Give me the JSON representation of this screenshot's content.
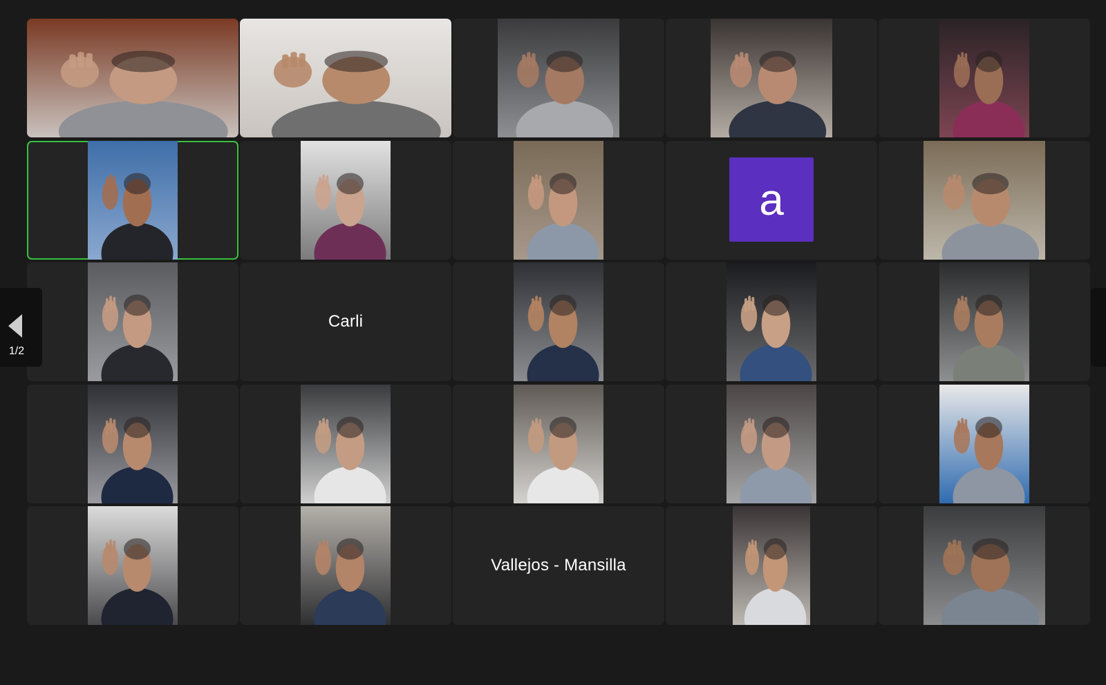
{
  "app": "Video meeting gallery view",
  "pager": {
    "label": "1/2"
  },
  "tiles": [
    {
      "kind": "video",
      "name": "participant-01",
      "bg": [
        "#7a3a24",
        "#c9c2bd"
      ],
      "skin": "#c49a82",
      "cloth": "#8f9196"
    },
    {
      "kind": "video",
      "name": "participant-02",
      "bg": [
        "#e8e5e2",
        "#c9c4bf"
      ],
      "skin": "#b78a6c",
      "cloth": "#6f6f70"
    },
    {
      "kind": "video",
      "name": "participant-03",
      "bg": [
        "#3b3b3d",
        "#8d8f93"
      ],
      "skin": "#a47a62",
      "cloth": "#a7a9ad"
    },
    {
      "kind": "video",
      "name": "participant-04",
      "bg": [
        "#3a3432",
        "#b4aca4"
      ],
      "skin": "#b88a72",
      "cloth": "#2f3542"
    },
    {
      "kind": "video",
      "name": "participant-05",
      "bg": [
        "#2a2326",
        "#7d4552"
      ],
      "skin": "#9a6d55",
      "cloth": "#8a2e57"
    },
    {
      "kind": "video",
      "name": "participant-06",
      "bg": [
        "#3f6ea8",
        "#8aa8cf"
      ],
      "skin": "#a26e52",
      "cloth": "#24252b",
      "active": true
    },
    {
      "kind": "video",
      "name": "participant-07",
      "bg": [
        "#e2e2e2",
        "#7b7b7b"
      ],
      "skin": "#caa48f",
      "cloth": "#6e2f57"
    },
    {
      "kind": "video",
      "name": "participant-08",
      "bg": [
        "#7a6a57",
        "#a7988b"
      ],
      "skin": "#c4987e",
      "cloth": "#8c98a7"
    },
    {
      "kind": "avatar",
      "name": "participant-avatar",
      "letter": "a",
      "color": "#5b2fbf"
    },
    {
      "kind": "video",
      "name": "participant-10",
      "bg": [
        "#7b6c57",
        "#bdb7aa"
      ],
      "skin": "#b78a6e",
      "cloth": "#8c939d"
    },
    {
      "kind": "video",
      "name": "participant-11",
      "bg": [
        "#5a5c60",
        "#9a9b9e"
      ],
      "skin": "#c49a82",
      "cloth": "#27292f"
    },
    {
      "kind": "name",
      "name": "participant-carli",
      "label": "Carli"
    },
    {
      "kind": "video",
      "name": "participant-13",
      "bg": [
        "#2f3136",
        "#8c8d90"
      ],
      "skin": "#b28362",
      "cloth": "#253049"
    },
    {
      "kind": "video",
      "name": "participant-14",
      "bg": [
        "#1b1c1f",
        "#6b6b6e"
      ],
      "skin": "#c8a085",
      "cloth": "#33507e"
    },
    {
      "kind": "video",
      "name": "participant-15",
      "bg": [
        "#2b2c2e",
        "#8e8f91"
      ],
      "skin": "#a97c5f",
      "cloth": "#7a8077"
    },
    {
      "kind": "video",
      "name": "participant-16",
      "bg": [
        "#2e3036",
        "#9a9aa0"
      ],
      "skin": "#b78a6e",
      "cloth": "#1e2a42"
    },
    {
      "kind": "video",
      "name": "participant-17",
      "bg": [
        "#3a3b3e",
        "#cfcfcf"
      ],
      "skin": "#c39c83",
      "cloth": "#e6e6e6"
    },
    {
      "kind": "video",
      "name": "participant-18",
      "bg": [
        "#5f5a55",
        "#d4d2cf"
      ],
      "skin": "#c29a80",
      "cloth": "#e7e7e7"
    },
    {
      "kind": "video",
      "name": "participant-19",
      "bg": [
        "#4b4545",
        "#a6a6a6"
      ],
      "skin": "#c39a83",
      "cloth": "#8e9aaa"
    },
    {
      "kind": "video",
      "name": "participant-20",
      "bg": [
        "#e8e8e8",
        "#2f6bb0"
      ],
      "skin": "#a8785c",
      "cloth": "#8d96a2"
    },
    {
      "kind": "video",
      "name": "participant-21",
      "bg": [
        "#dcdcdc",
        "#4b4b4e"
      ],
      "skin": "#b78a6e",
      "cloth": "#1f2430"
    },
    {
      "kind": "video",
      "name": "participant-22",
      "bg": [
        "#b4b0aa",
        "#2f3033"
      ],
      "skin": "#b48468",
      "cloth": "#2c3b57"
    },
    {
      "kind": "name",
      "name": "participant-vallejos",
      "label": "Vallejos - Mansilla"
    },
    {
      "kind": "video",
      "name": "participant-24",
      "bg": [
        "#3a3436",
        "#bdb8b1"
      ],
      "skin": "#c29676",
      "cloth": "#d9dadd"
    },
    {
      "kind": "video",
      "name": "participant-25",
      "bg": [
        "#3b3c3e",
        "#8c8d8f"
      ],
      "skin": "#9f7357",
      "cloth": "#7b8592"
    }
  ]
}
